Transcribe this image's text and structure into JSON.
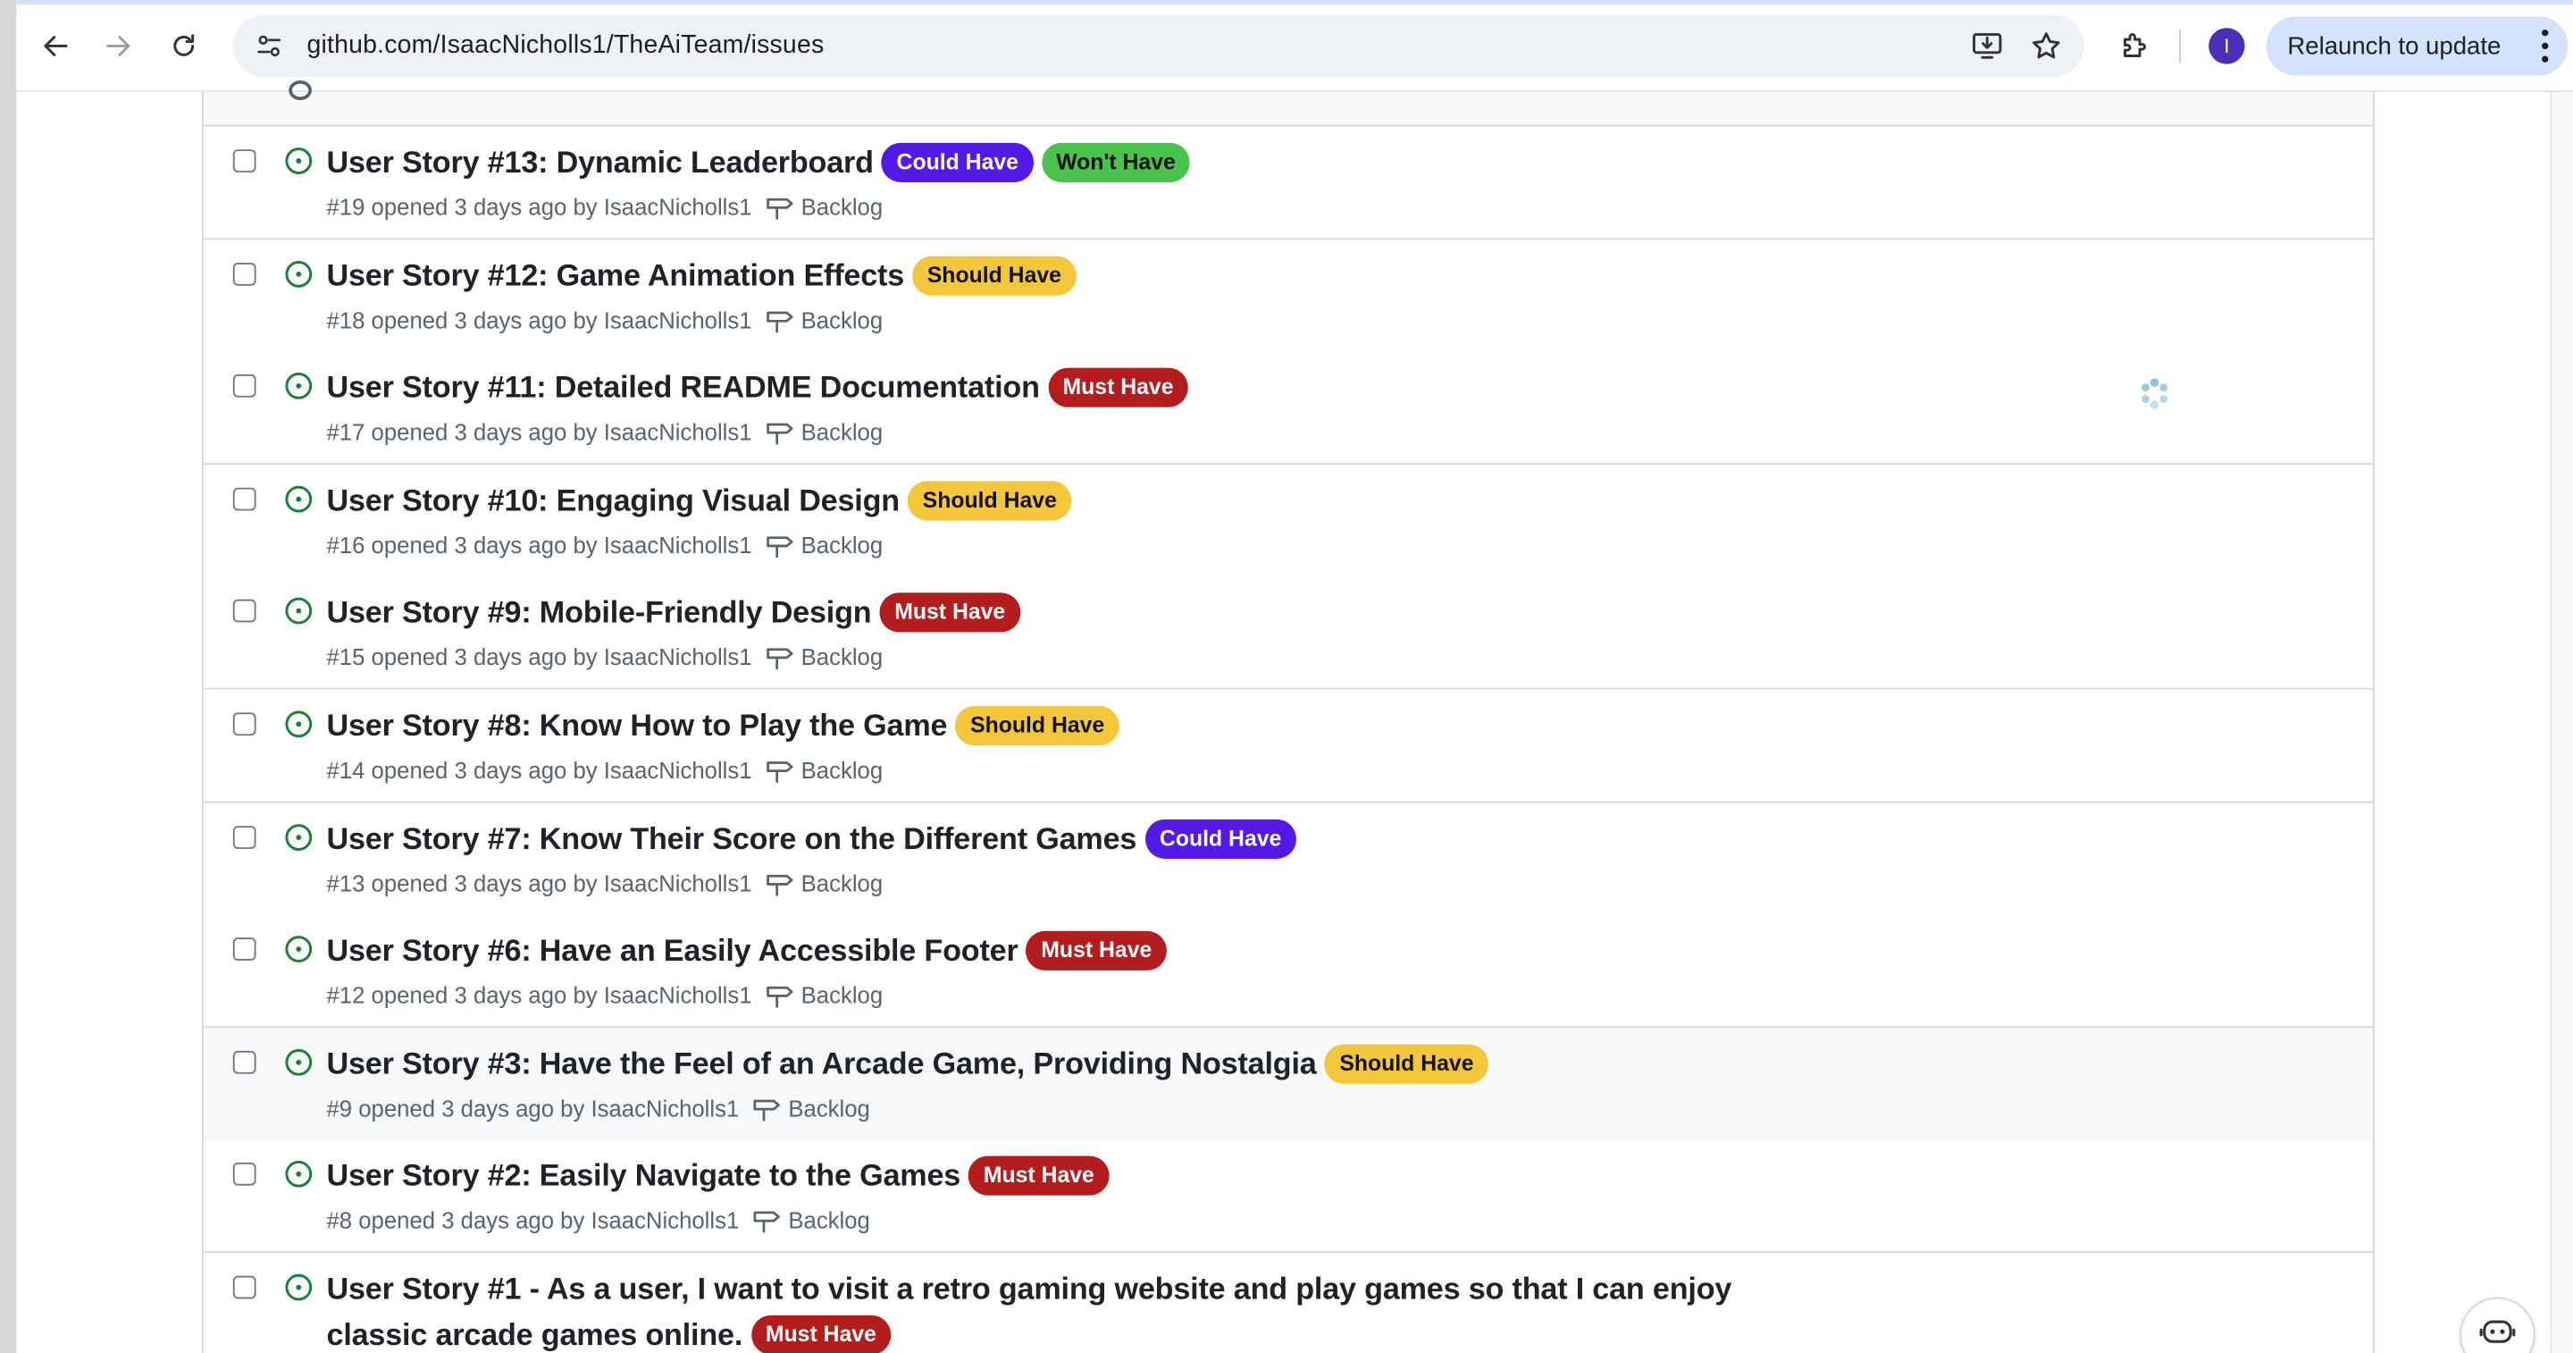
{
  "browser": {
    "url": "github.com/IsaacNicholls1/TheAiTeam/issues",
    "profile_initial": "I",
    "relaunch_label": "Relaunch to update"
  },
  "issues": [
    {
      "title": "User Story #13: Dynamic Leaderboard",
      "labels": [
        {
          "text": "Could Have",
          "kind": "could"
        },
        {
          "text": "Won't Have",
          "kind": "wont"
        }
      ],
      "number": "#19",
      "opened": "opened 3 days ago by",
      "author": "IsaacNicholls1",
      "milestone": "Backlog"
    },
    {
      "title": "User Story #12: Game Animation Effects",
      "labels": [
        {
          "text": "Should Have",
          "kind": "should"
        }
      ],
      "number": "#18",
      "opened": "opened 3 days ago by",
      "author": "IsaacNicholls1",
      "milestone": "Backlog"
    },
    {
      "title": "User Story #11: Detailed README Documentation",
      "labels": [
        {
          "text": "Must Have",
          "kind": "must"
        }
      ],
      "number": "#17",
      "opened": "opened 3 days ago by",
      "author": "IsaacNicholls1",
      "milestone": "Backlog"
    },
    {
      "title": "User Story #10: Engaging Visual Design",
      "labels": [
        {
          "text": "Should Have",
          "kind": "should"
        }
      ],
      "number": "#16",
      "opened": "opened 3 days ago by",
      "author": "IsaacNicholls1",
      "milestone": "Backlog"
    },
    {
      "title": "User Story #9: Mobile-Friendly Design",
      "labels": [
        {
          "text": "Must Have",
          "kind": "must"
        }
      ],
      "number": "#15",
      "opened": "opened 3 days ago by",
      "author": "IsaacNicholls1",
      "milestone": "Backlog"
    },
    {
      "title": "User Story #8: Know How to Play the Game",
      "labels": [
        {
          "text": "Should Have",
          "kind": "should"
        }
      ],
      "number": "#14",
      "opened": "opened 3 days ago by",
      "author": "IsaacNicholls1",
      "milestone": "Backlog"
    },
    {
      "title": "User Story #7: Know Their Score on the Different Games",
      "labels": [
        {
          "text": "Could Have",
          "kind": "could"
        }
      ],
      "number": "#13",
      "opened": "opened 3 days ago by",
      "author": "IsaacNicholls1",
      "milestone": "Backlog"
    },
    {
      "title": "User Story #6: Have an Easily Accessible Footer",
      "labels": [
        {
          "text": "Must Have",
          "kind": "must"
        }
      ],
      "number": "#12",
      "opened": "opened 3 days ago by",
      "author": "IsaacNicholls1",
      "milestone": "Backlog"
    },
    {
      "title": "User Story #3: Have the Feel of an Arcade Game, Providing Nostalgia",
      "labels": [
        {
          "text": "Should Have",
          "kind": "should"
        }
      ],
      "number": "#9",
      "opened": "opened 3 days ago by",
      "author": "IsaacNicholls1",
      "milestone": "Backlog"
    },
    {
      "title": "User Story #2: Easily Navigate to the Games",
      "labels": [
        {
          "text": "Must Have",
          "kind": "must"
        }
      ],
      "number": "#8",
      "opened": "opened 3 days ago by",
      "author": "IsaacNicholls1",
      "milestone": "Backlog"
    },
    {
      "title": "User Story #1 - As a user, I want to visit a retro gaming website and play games so that I can enjoy classic arcade games online.",
      "labels": [
        {
          "text": "Must Have",
          "kind": "must"
        }
      ],
      "number": "",
      "opened": "",
      "author": "",
      "milestone": ""
    }
  ],
  "colors": {
    "could_have": "#5319e7",
    "wont_have": "#4ac34c",
    "should_have": "#f3c739",
    "must_have": "#b31d1d",
    "open_issue_icon": "#1a7f37"
  },
  "icons": [
    "back-arrow-icon",
    "forward-arrow-icon",
    "reload-icon",
    "site-info-icon",
    "install-app-icon",
    "bookmark-star-icon",
    "extensions-icon",
    "open-issue-icon",
    "milestone-icon",
    "loading-spinner-icon",
    "copilot-icon"
  ]
}
